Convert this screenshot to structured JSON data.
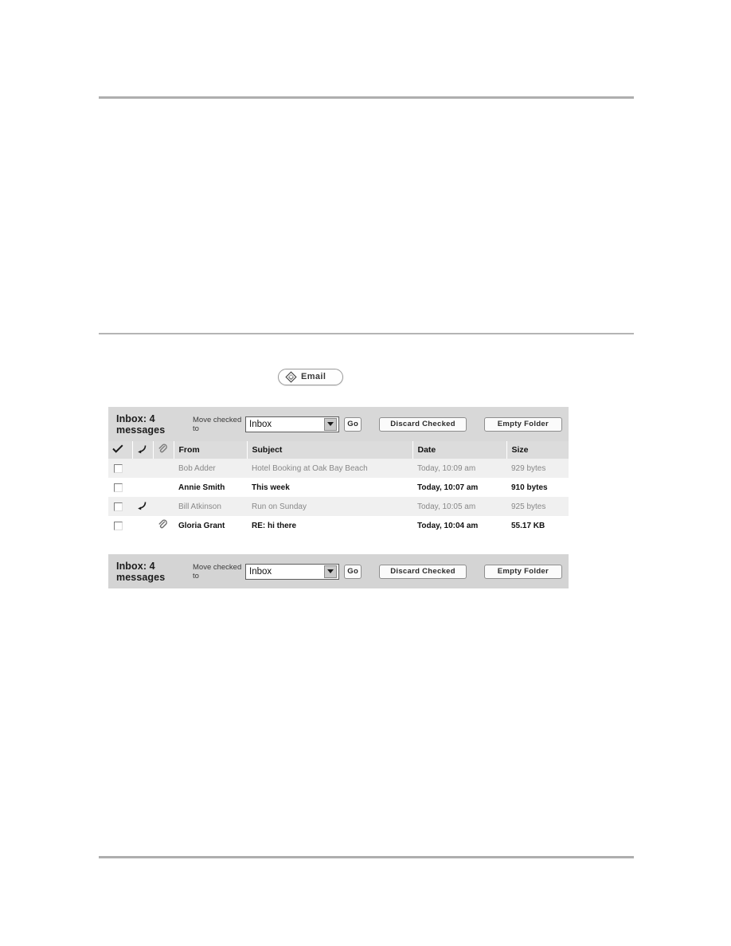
{
  "page": {
    "rules": [
      "top-rule",
      "middle-rule",
      "bottom-rule"
    ]
  },
  "email_button": {
    "label": "Email",
    "icon": "diamond-envelope-icon"
  },
  "toolbar": {
    "folder_status": "Inbox: 4 messages",
    "move_label": "Move checked to",
    "select_value": "Inbox",
    "select_options": [
      "Inbox"
    ],
    "go_label": "Go",
    "discard_label": "Discard Checked",
    "empty_label": "Empty Folder",
    "dropdown_icon": "chevron-down-icon"
  },
  "table": {
    "headers": {
      "check": "check-icon",
      "reply": "reply-icon",
      "attachment": "paperclip-icon",
      "from": "From",
      "subject": "Subject",
      "date": "Date",
      "size": "Size"
    },
    "rows": [
      {
        "from": "Bob Adder",
        "subject": "Hotel Booking at Oak Bay Beach",
        "date": "Today, 10:09 am",
        "size": "929 bytes",
        "read": true,
        "replied": false,
        "attachment": false,
        "checked": false
      },
      {
        "from": "Annie Smith",
        "subject": "This week",
        "date": "Today, 10:07 am",
        "size": "910 bytes",
        "read": false,
        "replied": false,
        "attachment": false,
        "checked": false
      },
      {
        "from": "Bill Atkinson",
        "subject": "Run on Sunday",
        "date": "Today, 10:05 am",
        "size": "925 bytes",
        "read": true,
        "replied": true,
        "attachment": false,
        "checked": false
      },
      {
        "from": "Gloria Grant",
        "subject": "RE: hi there",
        "date": "Today, 10:04 am",
        "size": "55.17 KB",
        "read": false,
        "replied": false,
        "attachment": true,
        "checked": false
      }
    ]
  },
  "colors": {
    "toolbar_bg": "#d8d8d8",
    "header_bg": "#dcdcdc",
    "row_read_bg": "#f0f0f0",
    "row_unread_bg": "#ffffff",
    "rule": "#aeaeae"
  }
}
